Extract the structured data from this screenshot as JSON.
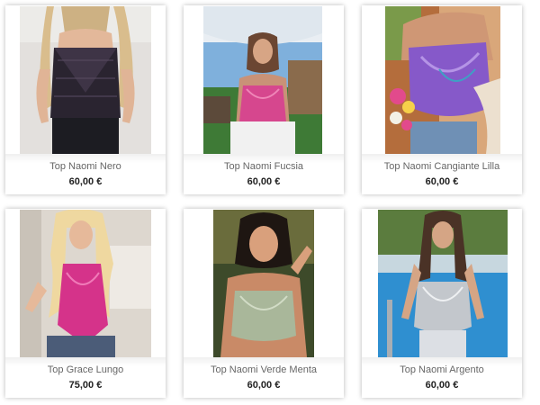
{
  "products": [
    {
      "name": "Top Naomi Nero",
      "price": "60,00 €",
      "image": "product-photo-black-top"
    },
    {
      "name": "Top Naomi Fucsia",
      "price": "60,00 €",
      "image": "product-photo-fuchsia-top"
    },
    {
      "name": "Top Naomi Cangiante Lilla",
      "price": "60,00 €",
      "image": "product-photo-lilac-top"
    },
    {
      "name": "Top Grace Lungo",
      "price": "75,00 €",
      "image": "product-photo-pink-long-top"
    },
    {
      "name": "Top Naomi Verde Menta",
      "price": "60,00 €",
      "image": "product-photo-mint-top"
    },
    {
      "name": "Top Naomi Argento",
      "price": "60,00 €",
      "image": "product-photo-silver-top"
    }
  ],
  "colors": {
    "card_background": "#ffffff",
    "name_text": "#666666",
    "price_text": "#222222"
  }
}
